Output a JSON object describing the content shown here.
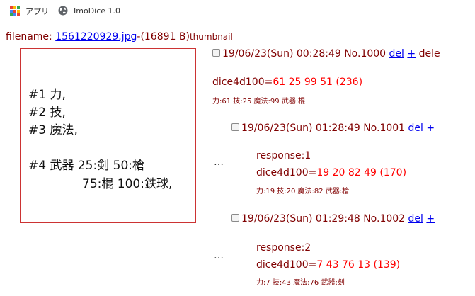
{
  "bookmarks": {
    "apps_label": "アプリ",
    "site_label": "ImoDice 1.0",
    "apps_colors": [
      "#ea4335",
      "#fbbc05",
      "#34a853",
      "#4285f4",
      "#ea4335",
      "#fbbc05",
      "#34a853",
      "#4285f4",
      "#ea4335"
    ]
  },
  "file": {
    "prefix": "filename: ",
    "name": "1561220929.jpg",
    "size": "-(16891 B)",
    "thumb_label": "thumbnail"
  },
  "thumbnail": {
    "lines": [
      "#1 力,",
      "#2 技,",
      "#3 魔法,",
      "#4 武器 25:剣 50:槍",
      "75:棍 100:鉄球,"
    ]
  },
  "posts": [
    {
      "date": "19/06/23(Sun) 00:28:49 No.1000",
      "del": "del",
      "plus": "+",
      "extra": "dele",
      "dice": "dice4d100=",
      "result": "61 25 99 51 (236)",
      "stats": "力:61 技:25 魔法:99 武器:棍"
    },
    {
      "date": "19/06/23(Sun) 01:28:49 No.1001",
      "del": "del",
      "plus": "+",
      "ellipsis": "…",
      "response": "response:1",
      "dice": "dice4d100=",
      "result": "19 20 82 49 (170)",
      "stats": "力:19 技:20 魔法:82 武器:槍"
    },
    {
      "date": "19/06/23(Sun) 01:29:48 No.1002",
      "del": "del",
      "plus": "+",
      "ellipsis": "…",
      "response": "response:2",
      "dice": "dice4d100=",
      "result": "7 43 76 13 (139)",
      "stats": "力:7 技:43 魔法:76 武器:剣"
    }
  ]
}
